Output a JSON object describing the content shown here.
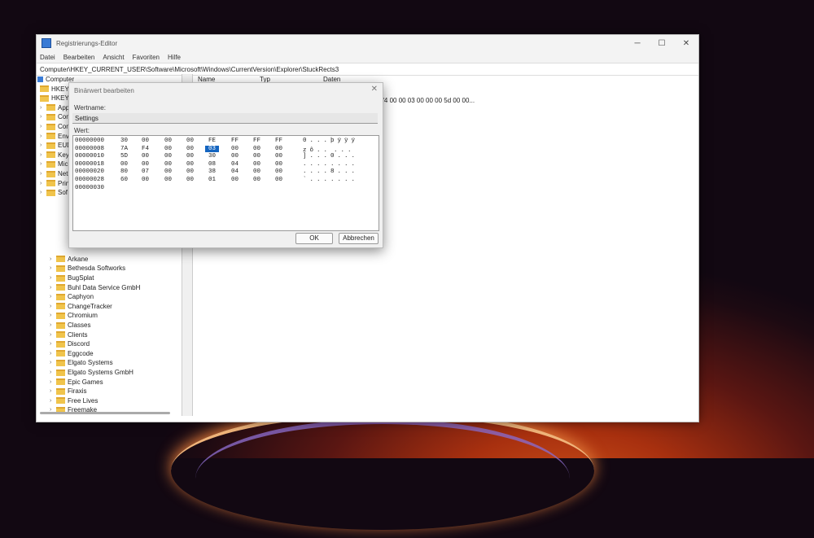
{
  "window": {
    "title": "Registrierungs-Editor",
    "min": "─",
    "max": "☐",
    "close": "✕"
  },
  "menu": [
    "Datei",
    "Bearbeiten",
    "Ansicht",
    "Favoriten",
    "Hilfe"
  ],
  "address": "Computer\\HKEY_CURRENT_USER\\Software\\Microsoft\\Windows\\CurrentVersion\\Explorer\\StuckRects3",
  "tree": {
    "root": "Computer",
    "top": [
      "HKEY_",
      "HKEY_",
      "App",
      "Con",
      "Con",
      "Env",
      "EUD",
      "Key",
      "Mic",
      "Net",
      "Prin",
      "Sof"
    ],
    "software": [
      "Arkane",
      "Bethesda Softworks",
      "BugSplat",
      "Buhl Data Service GmbH",
      "Caphyon",
      "ChangeTracker",
      "Chromium",
      "Classes",
      "Clients",
      "Discord",
      "Eggcode",
      "Elgato Systems",
      "Elgato Systems GmbH",
      "Epic Games",
      "Firaxis",
      "Free Lives",
      "Freemake"
    ]
  },
  "list": {
    "columns": [
      "Name",
      "Typ",
      "Daten"
    ],
    "row_data": "a f4 00 00 03 00 00 00 5d 00 00..."
  },
  "dialog": {
    "title": "Binärwert bearbeiten",
    "close": "✕",
    "name_label": "Wertname:",
    "name_value": "Settings",
    "value_label": "Wert:",
    "hex_rows": [
      {
        "addr": "00000000",
        "bytes": [
          "30",
          "00",
          "00",
          "00",
          "FE",
          "FF",
          "FF",
          "FF"
        ],
        "ascii": "0...þÿÿÿ"
      },
      {
        "addr": "00000008",
        "bytes": [
          "7A",
          "F4",
          "00",
          "00",
          "03",
          "00",
          "00",
          "00"
        ],
        "ascii": "zô..\u0003..."
      },
      {
        "addr": "00000010",
        "bytes": [
          "5D",
          "00",
          "00",
          "00",
          "30",
          "00",
          "00",
          "00"
        ],
        "ascii": "]...0..."
      },
      {
        "addr": "00000018",
        "bytes": [
          "00",
          "00",
          "00",
          "00",
          "08",
          "04",
          "00",
          "00"
        ],
        "ascii": "........"
      },
      {
        "addr": "00000020",
        "bytes": [
          "80",
          "07",
          "00",
          "00",
          "38",
          "04",
          "00",
          "00"
        ],
        "ascii": "....8..."
      },
      {
        "addr": "00000028",
        "bytes": [
          "60",
          "00",
          "00",
          "00",
          "01",
          "00",
          "00",
          "00"
        ],
        "ascii": "`......."
      },
      {
        "addr": "00000030",
        "bytes": [],
        "ascii": ""
      }
    ],
    "ok": "OK",
    "cancel": "Abbrechen"
  }
}
